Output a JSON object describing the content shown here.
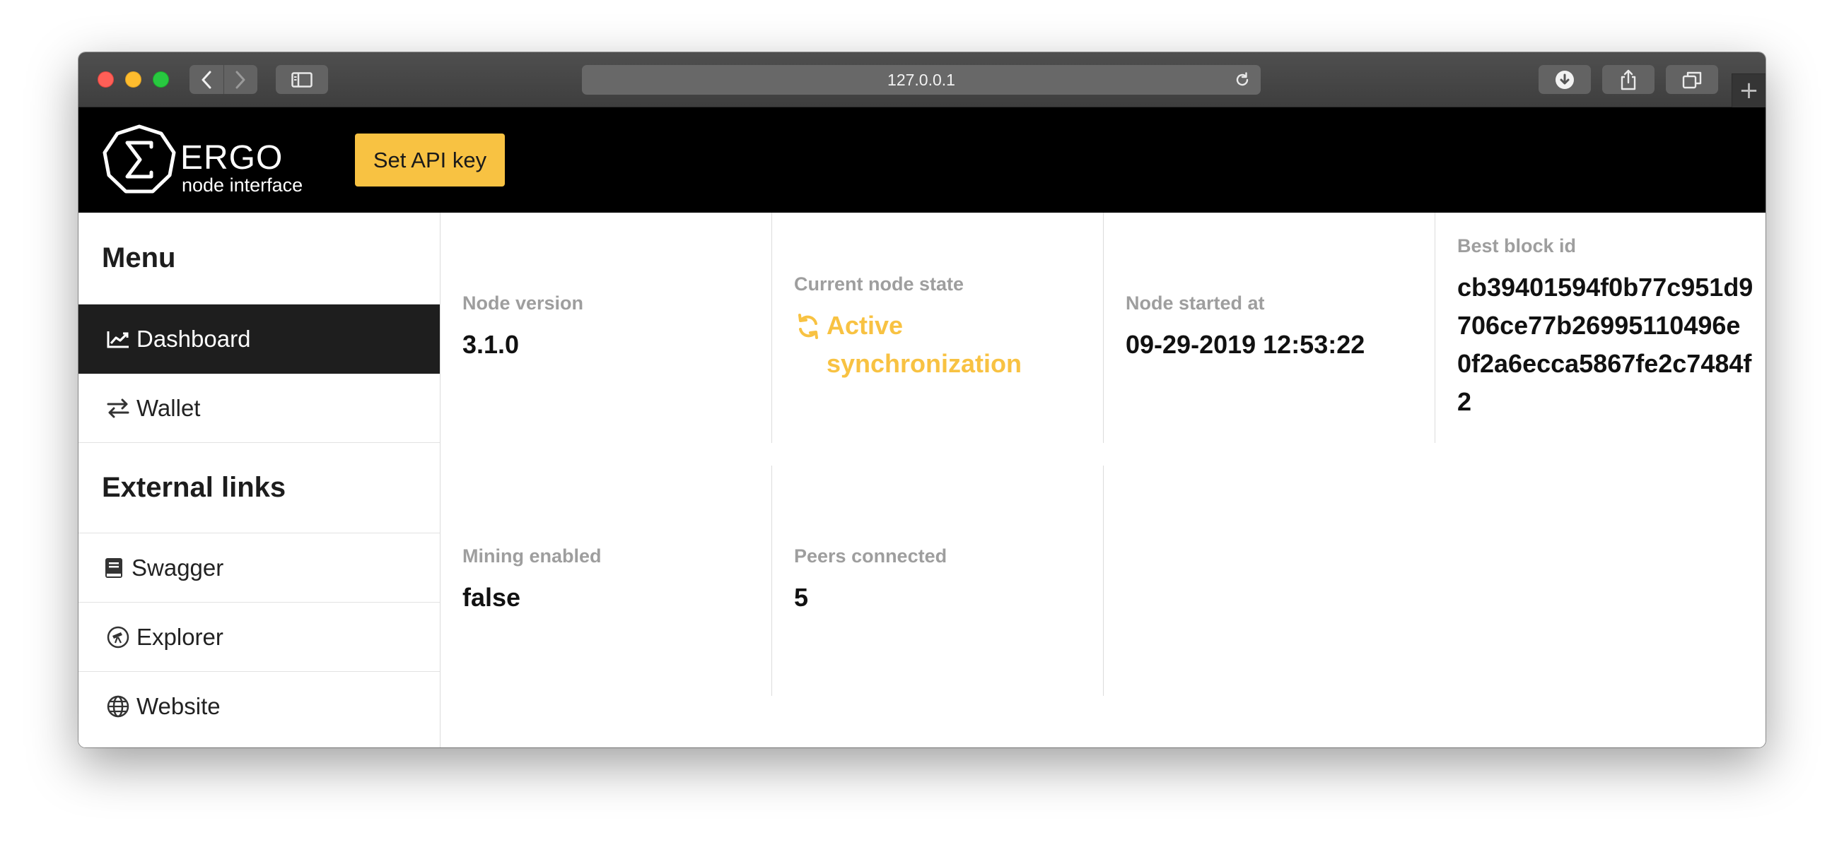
{
  "browser": {
    "url": "127.0.0.1"
  },
  "header": {
    "brand_name": "ERGO",
    "brand_sub": "node interface",
    "api_button_label": "Set API key",
    "accent_color": "#f8c242"
  },
  "sidebar": {
    "menu_heading": "Menu",
    "menu_items": [
      {
        "label": "Dashboard",
        "icon": "chart-line-icon",
        "active": true
      },
      {
        "label": "Wallet",
        "icon": "exchange-arrows-icon",
        "active": false
      }
    ],
    "external_heading": "External links",
    "external_items": [
      {
        "label": "Swagger",
        "icon": "book-icon"
      },
      {
        "label": "Explorer",
        "icon": "telescope-icon"
      },
      {
        "label": "Website",
        "icon": "globe-icon"
      }
    ]
  },
  "dashboard": {
    "node_version": {
      "label": "Node version",
      "value": "3.1.0"
    },
    "node_state": {
      "label": "Current node state",
      "value": "Active synchronization"
    },
    "node_started": {
      "label": "Node started at",
      "value": "09-29-2019 12:53:22"
    },
    "best_block": {
      "label": "Best block id",
      "value": "cb39401594f0b77c951d9706ce77b26995110496e0f2a6ecca5867fe2c7484f2"
    },
    "mining": {
      "label": "Mining enabled",
      "value": "false"
    },
    "peers": {
      "label": "Peers connected",
      "value": "5"
    }
  }
}
